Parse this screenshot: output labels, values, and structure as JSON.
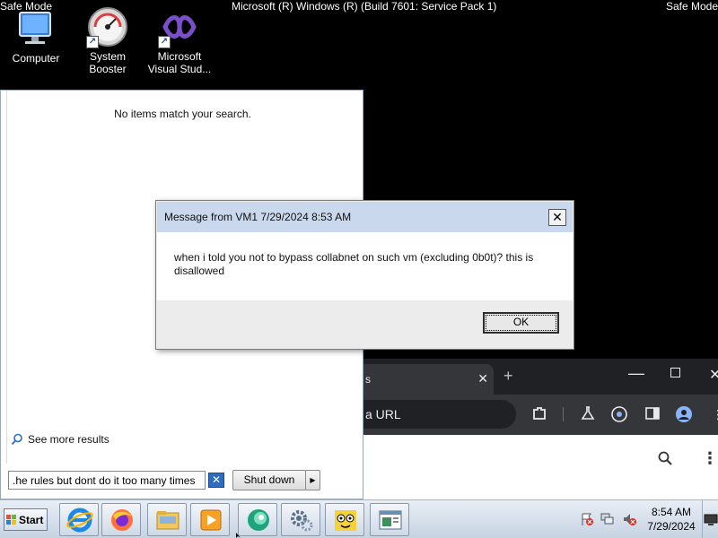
{
  "desktop": {
    "safe_mode_left": "Safe Mode",
    "safe_mode_right": "Safe Mode",
    "build_text": "Microsoft (R) Windows (R) (Build 7601: Service Pack 1)",
    "icons": [
      {
        "label": "Computer",
        "icon": "computer-icon"
      },
      {
        "label": "System Booster",
        "icon": "speedometer-icon"
      },
      {
        "label": "Microsoft Visual Stud...",
        "icon": "visual-studio-icon"
      }
    ]
  },
  "start_menu": {
    "no_items_text": "No items match your search.",
    "see_more_label": "See more results",
    "search_value": "he rules but dont do it too many times.",
    "shutdown_label": "Shut down"
  },
  "chrome": {
    "tab_title": "s",
    "omnibox_placeholder": "a URL",
    "colors": {
      "frame": "#202124",
      "toolbar": "#35363a",
      "text": "#e8eaed"
    }
  },
  "dialog": {
    "title": "Message from VM1 7/29/2024 8:53 AM",
    "message": "when i told you not to bypass collabnet on such vm (excluding 0b0t)? this is disallowed",
    "ok_label": "OK"
  },
  "taskbar": {
    "start_label": "Start",
    "apps": [
      {
        "icon": "internet-explorer-icon"
      },
      {
        "icon": "firefox-icon"
      },
      {
        "icon": "file-explorer-icon"
      },
      {
        "icon": "media-player-icon"
      },
      {
        "icon": "chrome-like-icon"
      },
      {
        "icon": "settings-gears-icon"
      },
      {
        "icon": "cartoon-cat-icon"
      },
      {
        "icon": "window-app-icon"
      }
    ],
    "clock_time": "8:54 AM",
    "clock_date": "7/29/2024"
  }
}
